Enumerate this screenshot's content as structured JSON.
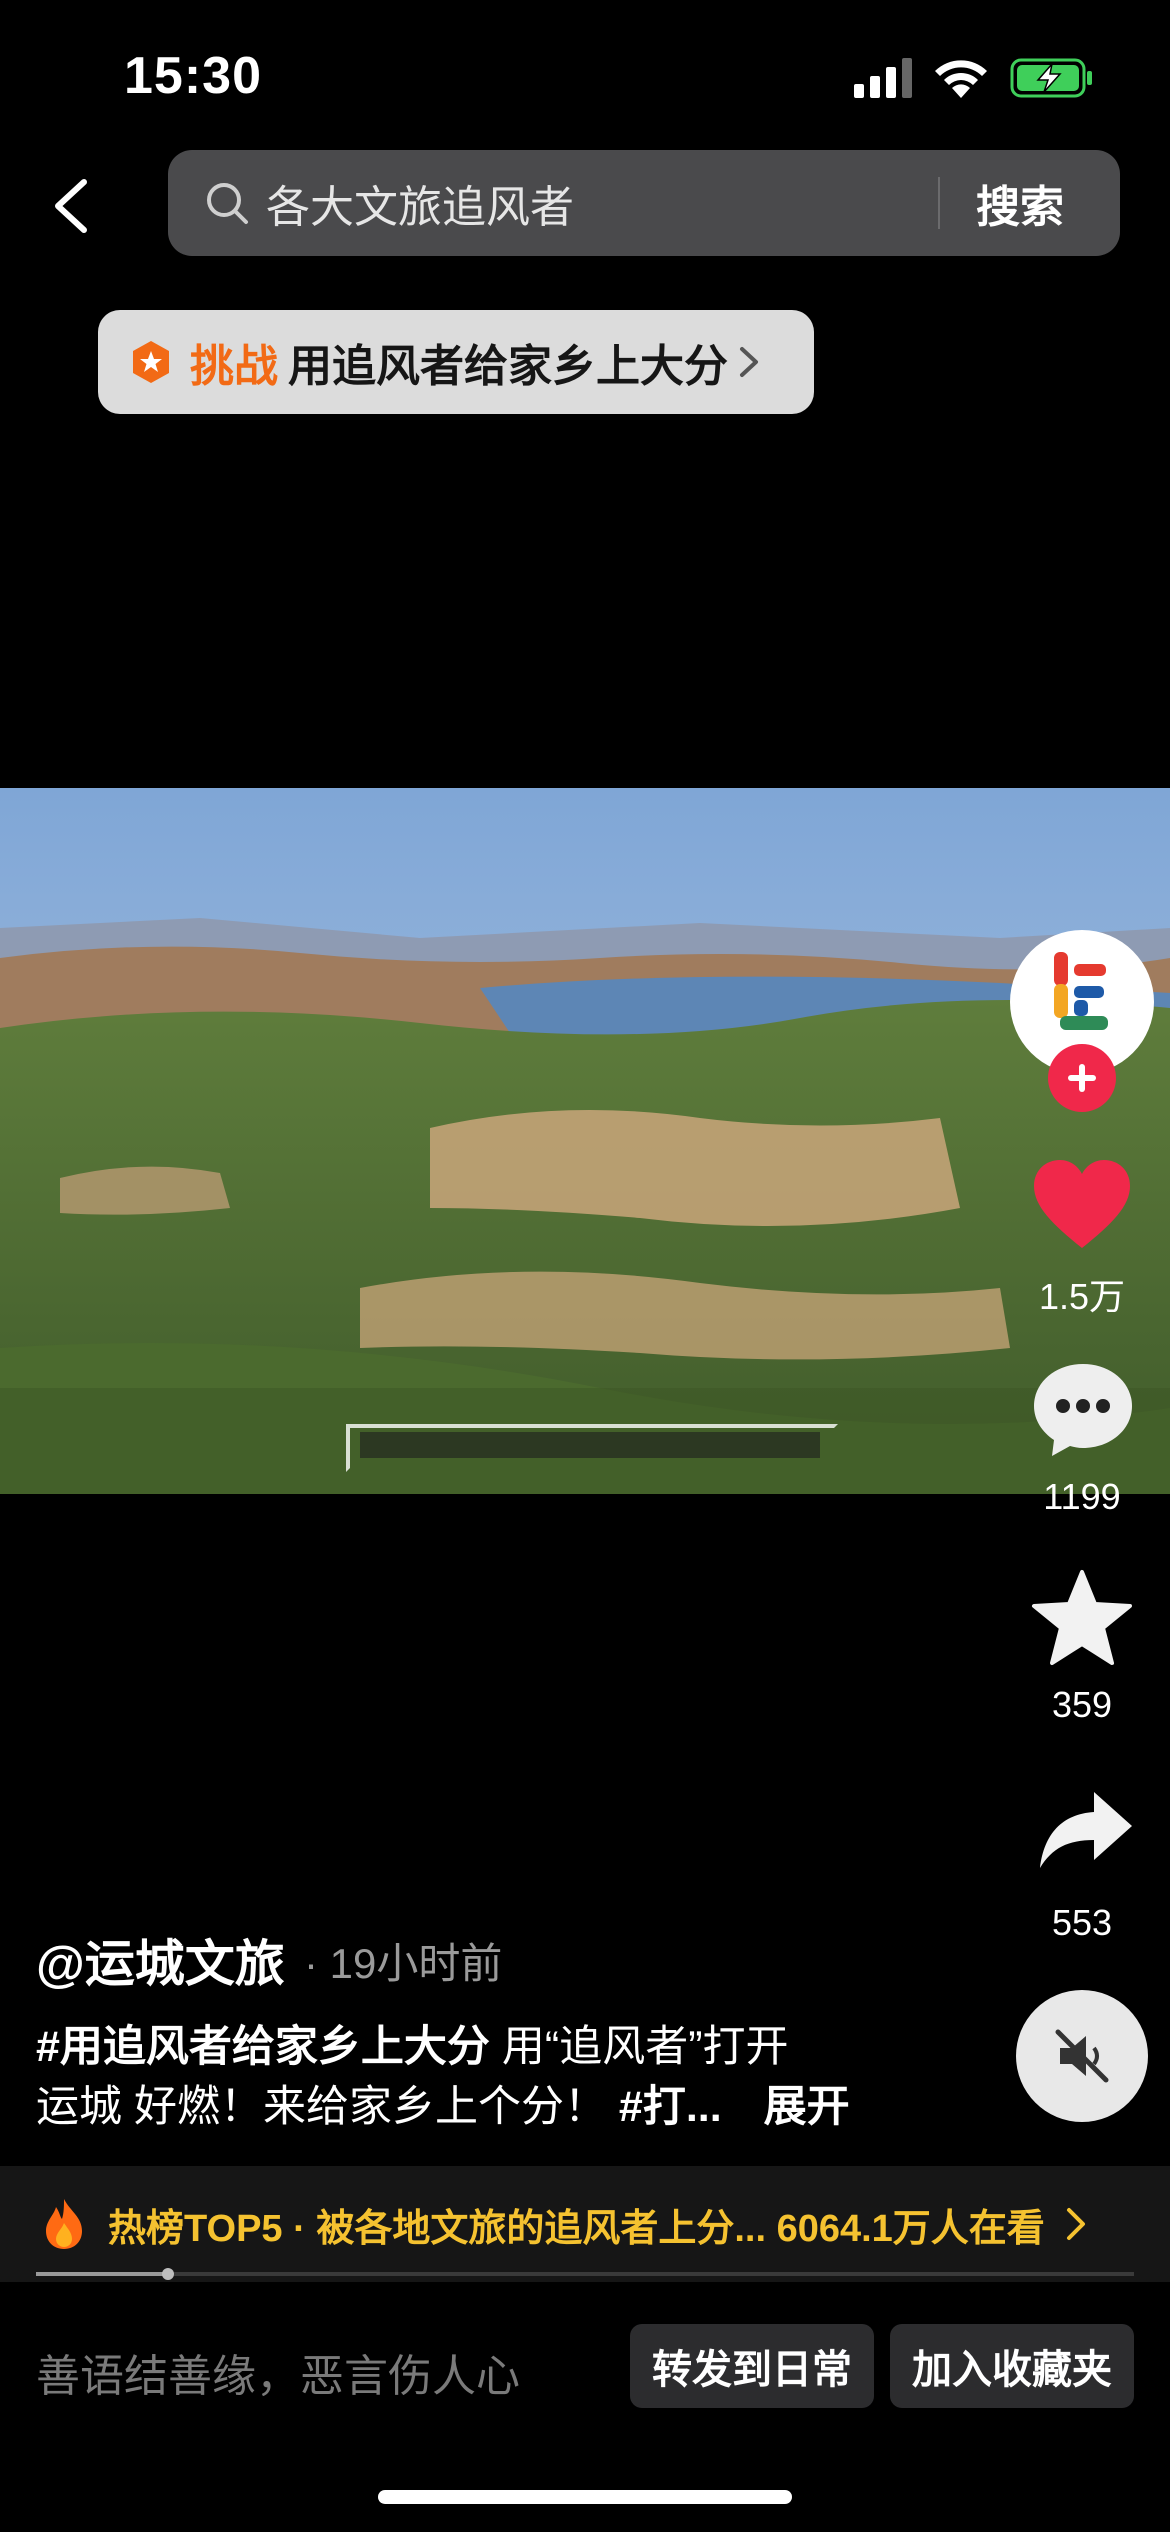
{
  "status_bar": {
    "time": "15:30"
  },
  "search": {
    "query": "各大文旅追风者",
    "button_label": "搜索"
  },
  "challenge": {
    "tag": "挑战",
    "title": "用追风者给家乡上大分"
  },
  "rail": {
    "like_count": "1.5万",
    "comment_count": "1199",
    "favorite_count": "359",
    "share_count": "553"
  },
  "post": {
    "author": "@运城文旅",
    "time": "· 19小时前",
    "caption_hashtag": "#用追风者给家乡上大分",
    "caption_line1_rest": " 用“追风者”打开",
    "caption_line2": "运城 好燃！来给家乡上个分！",
    "caption_line2_tag": "#打...",
    "expand_label": "展开"
  },
  "hot_banner": {
    "text": "热榜TOP5 · 被各地文旅的追风者上分...  6064.1万人在看"
  },
  "playback": {
    "progress_fraction": 0.12
  },
  "bottom_bar": {
    "comment_placeholder": "善语结善缘，恶言伤人心",
    "forward_label": "转发到日常",
    "collect_label": "加入收藏夹"
  },
  "colors": {
    "accent_red": "#f0284a",
    "challenge_orange": "#f26a15",
    "hot_yellow": "#f5c230"
  }
}
